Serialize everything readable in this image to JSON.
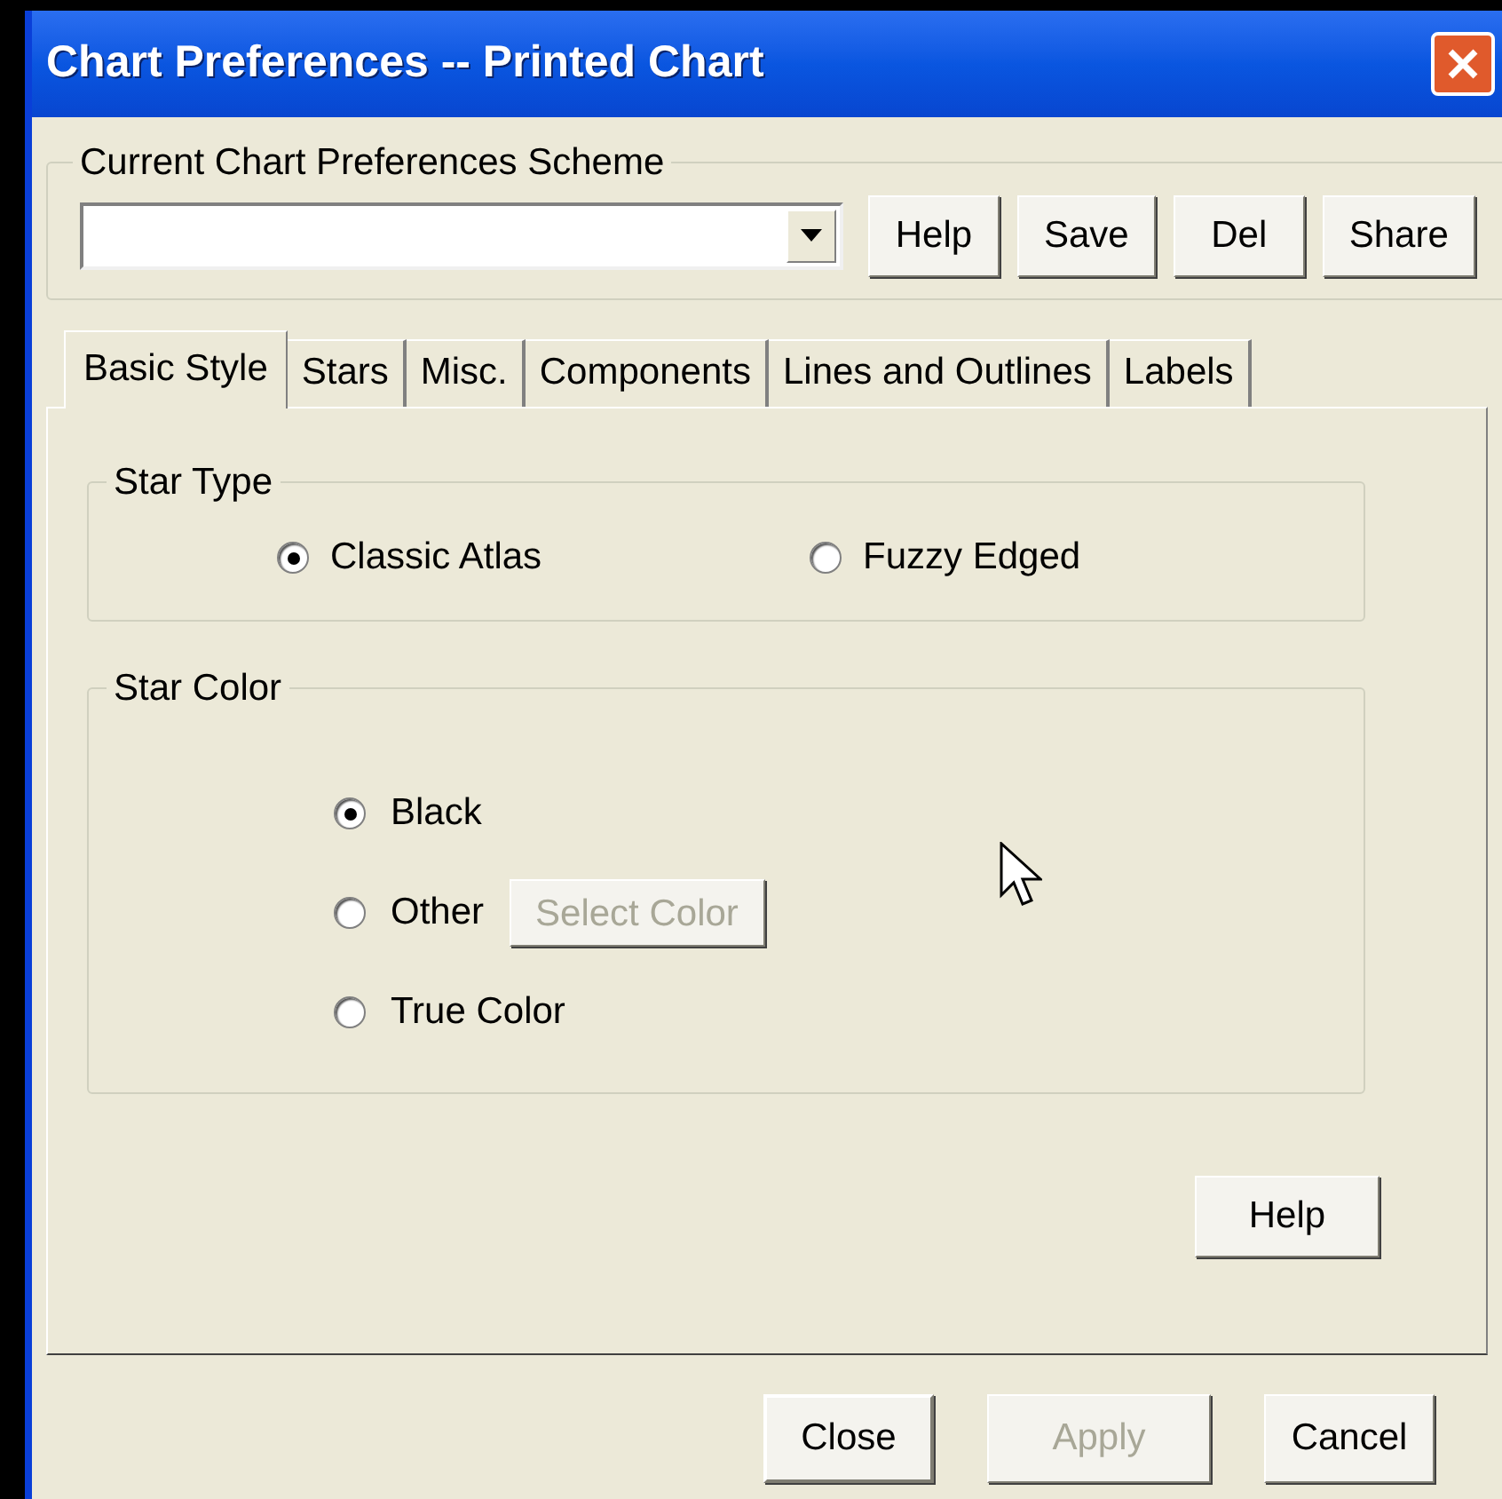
{
  "window": {
    "title": "Chart Preferences -- Printed Chart"
  },
  "scheme": {
    "legend": "Current Chart Preferences Scheme",
    "buttons": [
      {
        "label": "Help"
      },
      {
        "label": "Save"
      },
      {
        "label": "Del"
      },
      {
        "label": "Share"
      }
    ]
  },
  "tabs": [
    {
      "label": "Basic Style",
      "selected": true
    },
    {
      "label": "Stars",
      "selected": false
    },
    {
      "label": "Misc.",
      "selected": false
    },
    {
      "label": "Components",
      "selected": false
    },
    {
      "label": "Lines and Outlines",
      "selected": false
    },
    {
      "label": "Labels",
      "selected": false
    }
  ],
  "star_type": {
    "legend": "Star Type",
    "options": [
      {
        "label": "Classic Atlas",
        "selected": true
      },
      {
        "label": "Fuzzy Edged",
        "selected": false
      }
    ]
  },
  "star_color": {
    "legend": "Star Color",
    "options": [
      {
        "label": "Black",
        "selected": true
      },
      {
        "label": "Other",
        "selected": false,
        "button": {
          "label": "Select Color",
          "disabled": true
        }
      },
      {
        "label": "True Color",
        "selected": false
      }
    ]
  },
  "panel_button": {
    "label": "Help"
  },
  "footer_buttons": [
    {
      "label": "Close",
      "default": true,
      "disabled": false
    },
    {
      "label": "Apply",
      "default": false,
      "disabled": true
    },
    {
      "label": "Cancel",
      "default": false,
      "disabled": false
    }
  ]
}
